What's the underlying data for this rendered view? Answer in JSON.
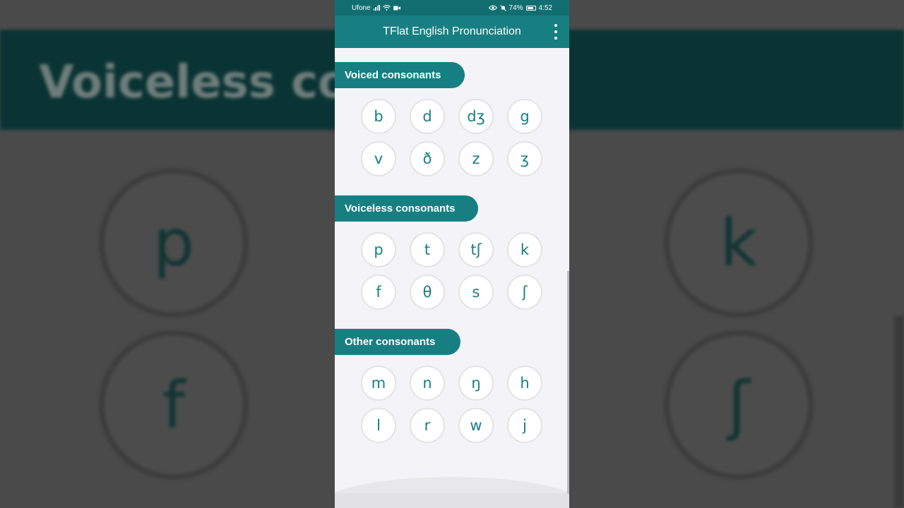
{
  "status_bar": {
    "carrier": "Ufone",
    "battery": "74%",
    "time": "4:52"
  },
  "app_bar": {
    "title": "TFlat English Pronunciation",
    "menu_icon": "more-vert-icon"
  },
  "background": {
    "title": "Voiceless cons",
    "symbols": [
      "p",
      "k",
      "f",
      "ʃ"
    ]
  },
  "sections": [
    {
      "label": "Voiced consonants",
      "symbols": [
        "b",
        "d",
        "dʒ",
        "g",
        "v",
        "ð",
        "z",
        "ʒ"
      ]
    },
    {
      "label": "Voiceless consonants",
      "symbols": [
        "p",
        "t",
        "tʃ",
        "k",
        "f",
        "θ",
        "s",
        "ʃ"
      ]
    },
    {
      "label": "Other consonants",
      "symbols": [
        "m",
        "n",
        "ŋ",
        "h",
        "l",
        "r",
        "w",
        "j"
      ]
    }
  ],
  "colors": {
    "accent": "#177f82",
    "status_bar": "#116e70",
    "background": "#f4f3f7"
  }
}
